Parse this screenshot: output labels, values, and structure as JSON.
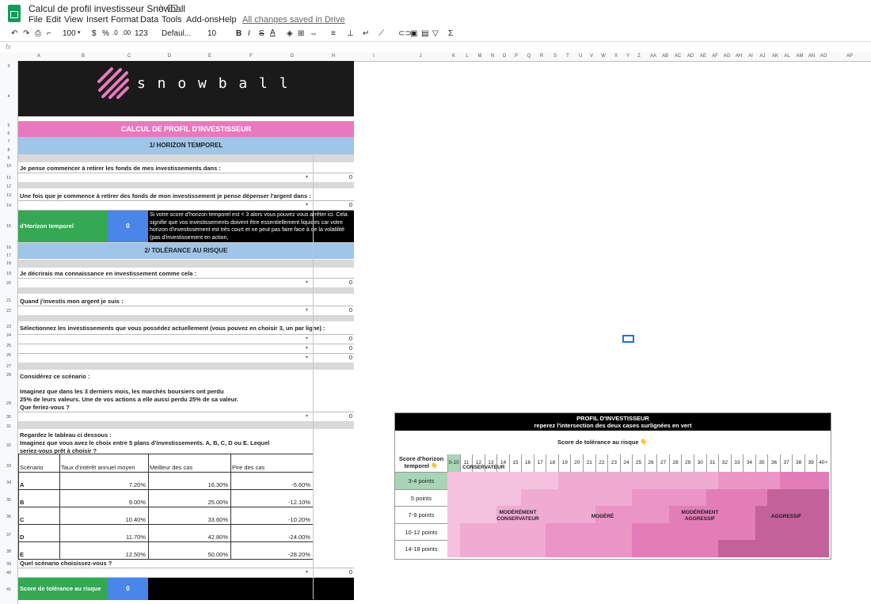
{
  "app": {
    "title": "Calcul de profil investisseur Snowball",
    "saved": "All changes saved in Drive",
    "menus": [
      "File",
      "Edit",
      "View",
      "Insert",
      "Format",
      "Data",
      "Tools",
      "Add-ons",
      "Help"
    ]
  },
  "toolbar": {
    "zoom": "100",
    "currency": "$",
    "percent": "%",
    "decimals_less": ".0",
    "decimals_more": ".00",
    "format_more": "123",
    "font": "Defaul...",
    "font_size": "10",
    "bold": "B",
    "italic": "I",
    "strike": "S",
    "text_color": "A"
  },
  "formula_bar": {
    "label": "fx"
  },
  "columns": [
    "A",
    "B",
    "C",
    "D",
    "E",
    "F",
    "G",
    "H",
    "I",
    "J",
    "K",
    "L",
    "M",
    "N",
    "O",
    "P",
    "Q",
    "R",
    "S",
    "T",
    "U",
    "V",
    "W",
    "X",
    "Y",
    "Z",
    "AA",
    "AB",
    "AC",
    "AD",
    "AE",
    "AF",
    "AG",
    "AH",
    "AI",
    "AJ",
    "AK",
    "AL",
    "AM",
    "AN",
    "AO",
    "AP"
  ],
  "rows": [
    "3",
    "4",
    "5",
    "6",
    "7",
    "8",
    "9",
    "10",
    "11",
    "12",
    "13",
    "14",
    "15",
    "16",
    "17",
    "18",
    "19",
    "20",
    "21",
    "22",
    "23",
    "24",
    "25",
    "26",
    "27",
    "28",
    "29",
    "30",
    "31",
    "32",
    "33",
    "34",
    "35",
    "36",
    "37",
    "38",
    "39",
    "40",
    "41",
    "42"
  ],
  "brand": {
    "name": "s n o w b a l l",
    "pink": "#e879bf",
    "dark": "#1a1a1a"
  },
  "colors": {
    "pink": "#e879bf",
    "blue": "#9fc5e8",
    "green": "#34a853",
    "score_blue": "#4a86e8",
    "gray": "#d9d9d9"
  },
  "sheet": {
    "title": "CALCUL DE PROFIL D'INVESTISSEUR",
    "section1": "1/ HORIZON TEMPOREL",
    "q1": "Je pense commencer à retirer les fonds de mes investissements dans :",
    "q1_value": "0",
    "q2": "Une fois que je commence à retirer des fonds de mon investissement je pense dépenser l'argent dans :",
    "q2_value": "0",
    "horizon_label": "d'Horizon temporel",
    "horizon_score": "0",
    "horizon_note": "Si votre score d'horizon temporel est < 3 alors vous pouvez vous arrêter ici. Cela signifie que vos investissements doivent être essentiellement liquides car votre horizon d'investissement est très court et ne peut pas faire face à de la volatilité (pas d'investissement en action,",
    "section2": "2/ TOLÉRANCE AU RISQUE",
    "q3": "Je décrirais ma connaissance en investissement comme cela :",
    "q3_value": "0",
    "q4": "Quand j'investis mon argent je suis :",
    "q4_value": "0",
    "q5": "Sélectionnez les investissements que vous possédez actuellement (vous pouvez en choisir 3, un par ligne) :",
    "q5_values": [
      "0",
      "0",
      "0"
    ],
    "scenario_title": "Considérez ce scénario :",
    "scenario_line1": "Imaginez que dans les 3 derniers mois, les marchés boursiers ont perdu",
    "scenario_line2": "25% de leurs valeurs. Une de vos actions a elle aussi perdu 25% de sa valeur.",
    "scenario_line3": "Que feriez-vous ?",
    "scenario_value": "0",
    "table_intro1": "Regardez le tableau ci dessous :",
    "table_intro2": "Imaginez que vous avez le choix entre 5 plans d'investissements. A, B, C, D ou E. Lequel",
    "table_intro3": "seriez-vous prêt à choisir ?",
    "table_headers": [
      "Scénario",
      "Taux d'intérêt annuel moyen",
      "Meilleur des cas",
      "Pire des cas"
    ],
    "table_rows": [
      [
        "A",
        "7.20%",
        "16.30%",
        "-5.60%"
      ],
      [
        "B",
        "9.00%",
        "25.00%",
        "-12.10%"
      ],
      [
        "C",
        "10.40%",
        "33.60%",
        "-10.20%"
      ],
      [
        "D",
        "11.70%",
        "42.80%",
        "-24.00%"
      ],
      [
        "E",
        "12.50%",
        "50.00%",
        "-28.20%"
      ]
    ],
    "q6": "Quel scénario choisissez-vous ?",
    "q6_value": "0",
    "risk_label": "Score de tolérance au risque",
    "risk_score": "0",
    "dropdown": "▾"
  },
  "profile": {
    "title": "PROFIL D'INVESTISSEUR",
    "subtitle": "reperez l'intersection des deux cases surlignées en vert",
    "x_label": "Score de tolérance au risque 👇",
    "y_label": "Score d'horizon temporel 👇",
    "cols": [
      "0-10",
      "11",
      "12",
      "13",
      "14",
      "15",
      "16",
      "17",
      "18",
      "19",
      "20",
      "21",
      "22",
      "23",
      "24",
      "25",
      "26",
      "27",
      "28",
      "29",
      "30",
      "31",
      "32",
      "33",
      "34",
      "35",
      "36",
      "37",
      "38",
      "39",
      "40+"
    ],
    "rows": [
      "3-4 points",
      "5 points",
      "7-9 points",
      "10-12 points",
      "14-18 points"
    ],
    "zones": [
      "CONSERVATEUR",
      "MODÉRÉMENT CONSERVATEUR",
      "MODÉRÉ",
      "MODÉRÉMENT AGGRESSIF",
      "AGGRESSIF"
    ],
    "zone_colors": [
      "#f4c2de",
      "#f0abd2",
      "#eb94c6",
      "#e37db8",
      "#c2619a"
    ],
    "highlight": "#a8d5b5"
  }
}
